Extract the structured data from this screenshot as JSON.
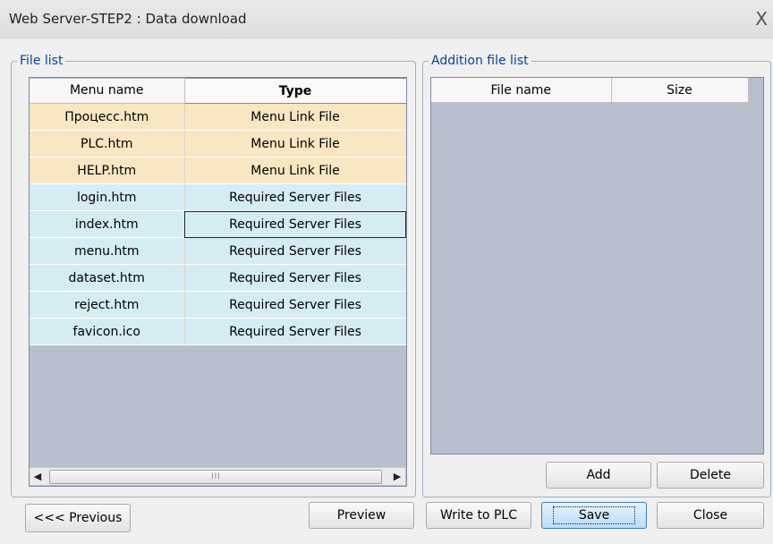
{
  "window": {
    "title": "Web Server-STEP2 : Data download",
    "close_glyph": "X"
  },
  "file_list": {
    "legend": "File list",
    "columns": [
      "Menu name",
      "Type"
    ],
    "rows": [
      {
        "name": "Процесс.htm",
        "type": "Menu Link File",
        "group": "menu"
      },
      {
        "name": "PLC.htm",
        "type": "Menu Link File",
        "group": "menu"
      },
      {
        "name": "HELP.htm",
        "type": "Menu Link File",
        "group": "menu"
      },
      {
        "name": "login.htm",
        "type": "Required Server Files",
        "group": "req"
      },
      {
        "name": "index.htm",
        "type": "Required Server Files",
        "group": "req",
        "selected": true
      },
      {
        "name": "menu.htm",
        "type": "Required Server Files",
        "group": "req"
      },
      {
        "name": "dataset.htm",
        "type": "Required Server Files",
        "group": "req"
      },
      {
        "name": "reject.htm",
        "type": "Required Server Files",
        "group": "req"
      },
      {
        "name": "favicon.ico",
        "type": "Required Server Files",
        "group": "req"
      }
    ],
    "scroll_left_glyph": "◀",
    "scroll_right_glyph": "▶",
    "scroll_grip": "III"
  },
  "addition_list": {
    "legend": "Addition file list",
    "columns": [
      "File name",
      "Size"
    ],
    "rows": []
  },
  "buttons": {
    "add": "Add",
    "delete": "Delete",
    "previous": "<<< Previous",
    "preview": "Preview",
    "write_to_plc": "Write to PLC",
    "save": "Save",
    "close": "Close"
  },
  "colors": {
    "menu_row": "#f8e7c2",
    "required_row": "#d6ecf3",
    "empty_area": "#b8bfcc",
    "legend_text": "#0b3ea6"
  }
}
